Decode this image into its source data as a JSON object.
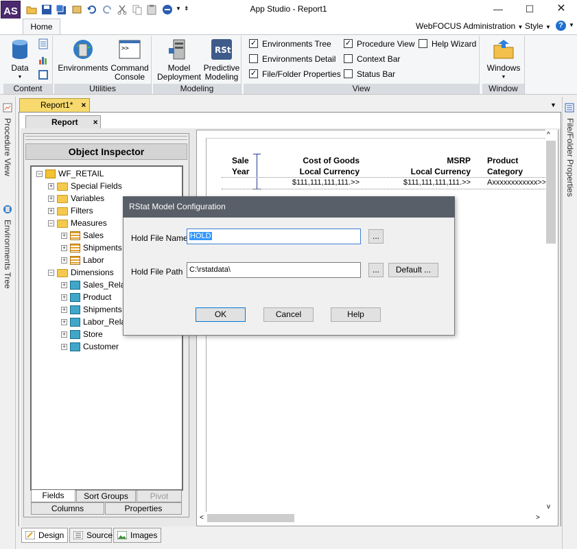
{
  "window": {
    "title": "App Studio - Report1",
    "app_icon": "AS",
    "controls": [
      "minimize-icon",
      "maximize-icon",
      "close-icon"
    ]
  },
  "quick_access": [
    "open-icon",
    "save-icon",
    "save-all-icon",
    "run-icon",
    "undo-icon",
    "redo-icon",
    "cut-icon",
    "copy-icon",
    "paste-icon",
    "publish-icon"
  ],
  "ribbon": {
    "tabs": [
      {
        "label": "Home"
      }
    ],
    "right": {
      "admin": "WebFOCUS Administration",
      "style": "Style",
      "help": "?"
    },
    "groups": {
      "content": {
        "label": "Content",
        "data_button": "Data"
      },
      "utilities": {
        "label": "Utilities",
        "environments": "Environments",
        "command_console_1": "Command",
        "command_console_2": "Console"
      },
      "modeling": {
        "label": "Modeling",
        "model_deployment_1": "Model",
        "model_deployment_2": "Deployment",
        "predictive_modeling_1": "Predictive",
        "predictive_modeling_2": "Modeling"
      },
      "view": {
        "label": "View",
        "items": [
          {
            "label": "Environments Tree",
            "checked": true
          },
          {
            "label": "Environments Detail",
            "checked": false
          },
          {
            "label": "File/Folder Properties",
            "checked": true
          },
          {
            "label": "Procedure View",
            "checked": true
          },
          {
            "label": "Context Bar",
            "checked": false
          },
          {
            "label": "Status Bar",
            "checked": false
          },
          {
            "label": "Help Wizard",
            "checked": false
          }
        ]
      },
      "window": {
        "label": "Window",
        "windows_button": "Windows"
      }
    }
  },
  "side_panels": {
    "left": [
      "Procedure View",
      "Environments Tree"
    ],
    "right": "File/Folder Properties"
  },
  "document_tab": {
    "label": "Report1*",
    "close": "×"
  },
  "report_tab": {
    "label": "Report",
    "close": "×"
  },
  "object_inspector": {
    "title": "Object Inspector",
    "tree": {
      "root": "WF_RETAIL",
      "items": [
        "Special Fields",
        "Variables",
        "Filters",
        "Measures",
        "Sales",
        "Shipments",
        "Labor",
        "Dimensions",
        "Sales_Rela",
        "Product",
        "Shipments",
        "Labor_Rela",
        "Store",
        "Customer"
      ]
    },
    "tabs_row1": [
      "Fields",
      "Sort Groups",
      "Pivot"
    ],
    "tabs_row2": [
      "Columns",
      "Properties"
    ]
  },
  "report": {
    "headers": [
      {
        "line1": "Sale",
        "line2": "Year"
      },
      {
        "line1": "Cost of Goods",
        "line2": "Local Currency"
      },
      {
        "line1": "MSRP",
        "line2": "Local Currency"
      },
      {
        "line1": "Product",
        "line2": "Category"
      }
    ],
    "values": [
      "$111,111,111,111.>>",
      "$111,111,111,111.>>",
      "Axxxxxxxxxxxx>>"
    ]
  },
  "bottom_tabs": [
    "Design",
    "Source",
    "Images"
  ],
  "dialog": {
    "title": "RStat Model Configuration",
    "hold_file_name_label": "Hold File Name",
    "hold_file_name_value": "HOLD",
    "hold_file_path_label": "Hold File Path",
    "hold_file_path_value": "C:\\rstatdata\\",
    "browse": "...",
    "default_button": "Default ...",
    "ok": "OK",
    "cancel": "Cancel",
    "help": "Help"
  }
}
